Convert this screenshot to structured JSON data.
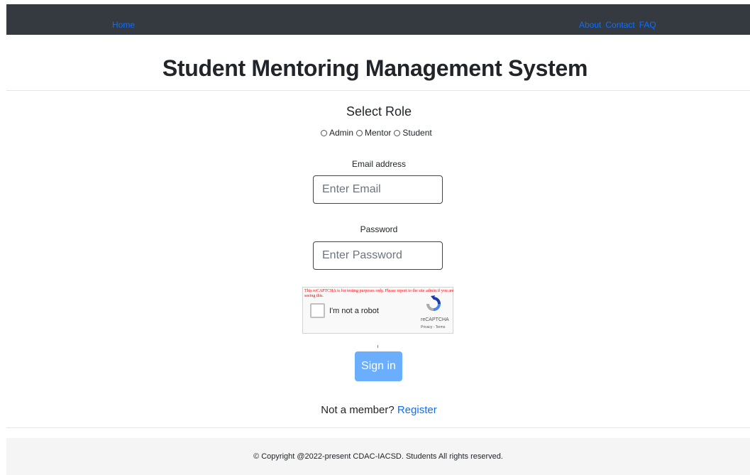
{
  "nav": {
    "home": "Home",
    "about": "About",
    "contact": "Contact",
    "faq": "FAQ"
  },
  "page_title": "Student Mentoring Management System",
  "role": {
    "heading": "Select Role",
    "options": [
      "Admin",
      "Mentor",
      "Student"
    ]
  },
  "email": {
    "label": "Email address",
    "placeholder": "Enter Email"
  },
  "password": {
    "label": "Password",
    "placeholder": "Enter Password"
  },
  "captcha": {
    "warning": "This reCAPTCHA is for testing purposes only. Please report to the site admin if you are seeing this.",
    "checkbox_label": "I'm not a robot",
    "brand": "reCAPTCHA",
    "links": "Privacy - Terms"
  },
  "signin_label": "Sign in",
  "member": {
    "prompt": "Not a member?",
    "register": "Register"
  },
  "footer": "© Copyright @2022-present CDAC-IACSD. Students All rights reserved.",
  "colors": {
    "navbar": "#343a40",
    "link": "#0d6efd",
    "button": "#6aaefc",
    "footer_bg": "#f5f5f5"
  }
}
